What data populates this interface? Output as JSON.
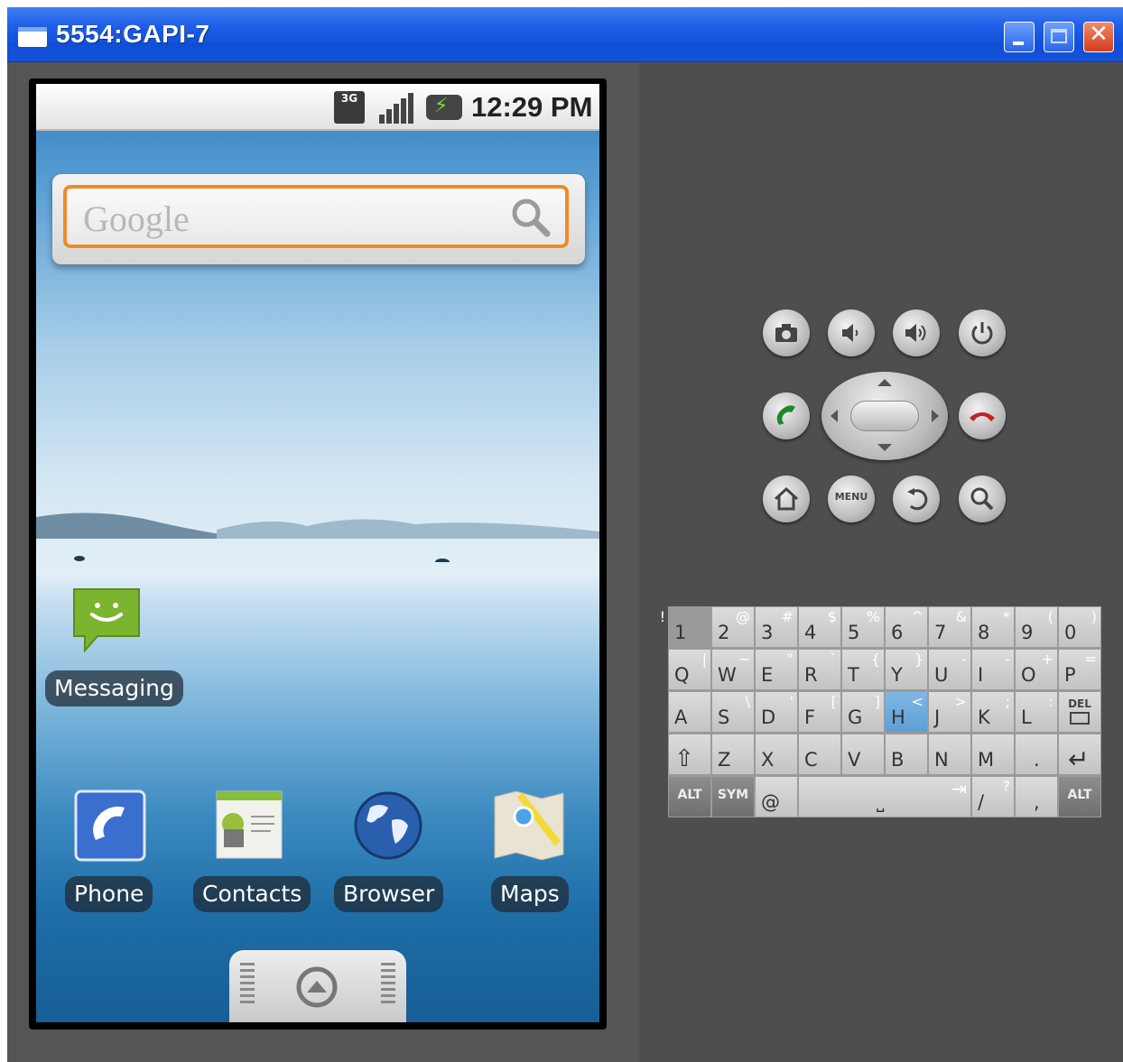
{
  "window": {
    "title": "5554:GAPI-7",
    "close_glyph": "✕"
  },
  "phone": {
    "status_time": "12:29 PM",
    "network": "3G",
    "search_hint": "Google",
    "apps": {
      "messaging": "Messaging",
      "phone": "Phone",
      "contacts": "Contacts",
      "browser": "Browser",
      "maps": "Maps"
    }
  },
  "controls": {
    "menu_label": "MENU",
    "top_row_icons": [
      "camera-icon",
      "volume-down-icon",
      "volume-up-icon",
      "power-icon"
    ],
    "bottom_row_icons": [
      "home-icon",
      "menu-icon",
      "back-icon",
      "search-icon"
    ]
  },
  "keyboard": {
    "row1": [
      {
        "main": "1",
        "sub": "!"
      },
      {
        "main": "2",
        "sub": "@"
      },
      {
        "main": "3",
        "sub": "#"
      },
      {
        "main": "4",
        "sub": "$"
      },
      {
        "main": "5",
        "sub": "%"
      },
      {
        "main": "6",
        "sub": "^"
      },
      {
        "main": "7",
        "sub": "&"
      },
      {
        "main": "8",
        "sub": "*"
      },
      {
        "main": "9",
        "sub": "("
      },
      {
        "main": "0",
        "sub": ")"
      }
    ],
    "row2": [
      {
        "main": "Q",
        "sub": "|"
      },
      {
        "main": "W",
        "sub": "~"
      },
      {
        "main": "E",
        "sub": "\""
      },
      {
        "main": "R",
        "sub": "`"
      },
      {
        "main": "T",
        "sub": "{"
      },
      {
        "main": "Y",
        "sub": "}"
      },
      {
        "main": "U",
        "sub": "-"
      },
      {
        "main": "I",
        "sub": "-"
      },
      {
        "main": "O",
        "sub": "+"
      },
      {
        "main": "P",
        "sub": "="
      }
    ],
    "row3": [
      {
        "main": "A",
        "sub": ""
      },
      {
        "main": "S",
        "sub": "\\"
      },
      {
        "main": "D",
        "sub": "'"
      },
      {
        "main": "F",
        "sub": "["
      },
      {
        "main": "G",
        "sub": "]"
      },
      {
        "main": "H",
        "sub": "<"
      },
      {
        "main": "J",
        "sub": ">"
      },
      {
        "main": "K",
        "sub": ";"
      },
      {
        "main": "L",
        "sub": ":"
      },
      {
        "main": "DEL",
        "sub": ""
      }
    ],
    "row4": [
      {
        "main": "⇧",
        "sub": ""
      },
      {
        "main": "Z",
        "sub": ""
      },
      {
        "main": "X",
        "sub": ""
      },
      {
        "main": "C",
        "sub": ""
      },
      {
        "main": "V",
        "sub": ""
      },
      {
        "main": "B",
        "sub": ""
      },
      {
        "main": "N",
        "sub": ""
      },
      {
        "main": "M",
        "sub": ""
      },
      {
        "main": ".",
        "sub": ""
      },
      {
        "main": "↵",
        "sub": ""
      }
    ],
    "row5": {
      "alt": "ALT",
      "sym": "SYM",
      "at": "@",
      "space": "⎵",
      "tab": "⇥",
      "slash": "/",
      "question": "?",
      "comma": ",",
      "alt2": "ALT"
    },
    "active_key": "H"
  }
}
